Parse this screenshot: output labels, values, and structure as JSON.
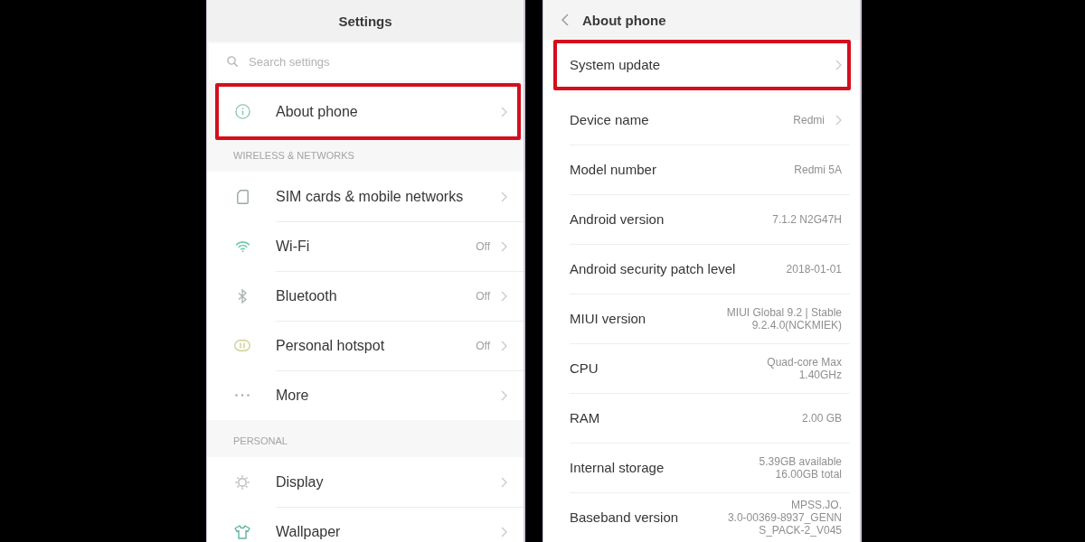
{
  "settings_screen": {
    "title": "Settings",
    "search": {
      "placeholder": "Search settings"
    },
    "groups": [
      {
        "items": [
          {
            "label": "About phone",
            "highlighted": true
          }
        ]
      },
      {
        "header": "WIRELESS & NETWORKS",
        "items": [
          {
            "label": "SIM cards & mobile networks",
            "highlighted": false
          },
          {
            "label": "Wi-Fi",
            "value": "Off",
            "highlighted": false
          },
          {
            "label": "Bluetooth",
            "value": "Off",
            "highlighted": false
          },
          {
            "label": "Personal hotspot",
            "value": "Off",
            "highlighted": false
          },
          {
            "label": "More",
            "highlighted": false
          }
        ]
      },
      {
        "header": "PERSONAL",
        "items": [
          {
            "label": "Display",
            "highlighted": false
          },
          {
            "label": "Wallpaper",
            "highlighted": false
          }
        ]
      }
    ]
  },
  "about_screen": {
    "title": "About phone",
    "items": [
      {
        "label": "System update",
        "chevron": true,
        "highlighted": true
      },
      {
        "label": "Device name",
        "value": "Redmi",
        "chevron": true,
        "highlighted": false
      },
      {
        "label": "Model number",
        "value": "Redmi 5A",
        "chevron": false,
        "highlighted": false
      },
      {
        "label": "Android version",
        "value": "7.1.2 N2G47H",
        "chevron": false,
        "highlighted": false
      },
      {
        "label": "Android security patch level",
        "value": "2018-01-01",
        "chevron": false,
        "highlighted": false
      },
      {
        "label": "MIUI version",
        "value": "MIUI Global 9.2 | Stable\n9.2.4.0(NCKMIEK)",
        "chevron": false,
        "highlighted": false
      },
      {
        "label": "CPU",
        "value": "Quad-core Max\n1.40GHz",
        "chevron": false,
        "highlighted": false
      },
      {
        "label": "RAM",
        "value": "2.00 GB",
        "chevron": false,
        "highlighted": false
      },
      {
        "label": "Internal storage",
        "value": "5.39GB available\n16.00GB total",
        "chevron": false,
        "highlighted": false
      },
      {
        "label": "Baseband version",
        "value": "MPSS.JO.\n3.0-00369-8937_GENN\nS_PACK-2_V045",
        "chevron": false,
        "highlighted": false
      }
    ]
  }
}
